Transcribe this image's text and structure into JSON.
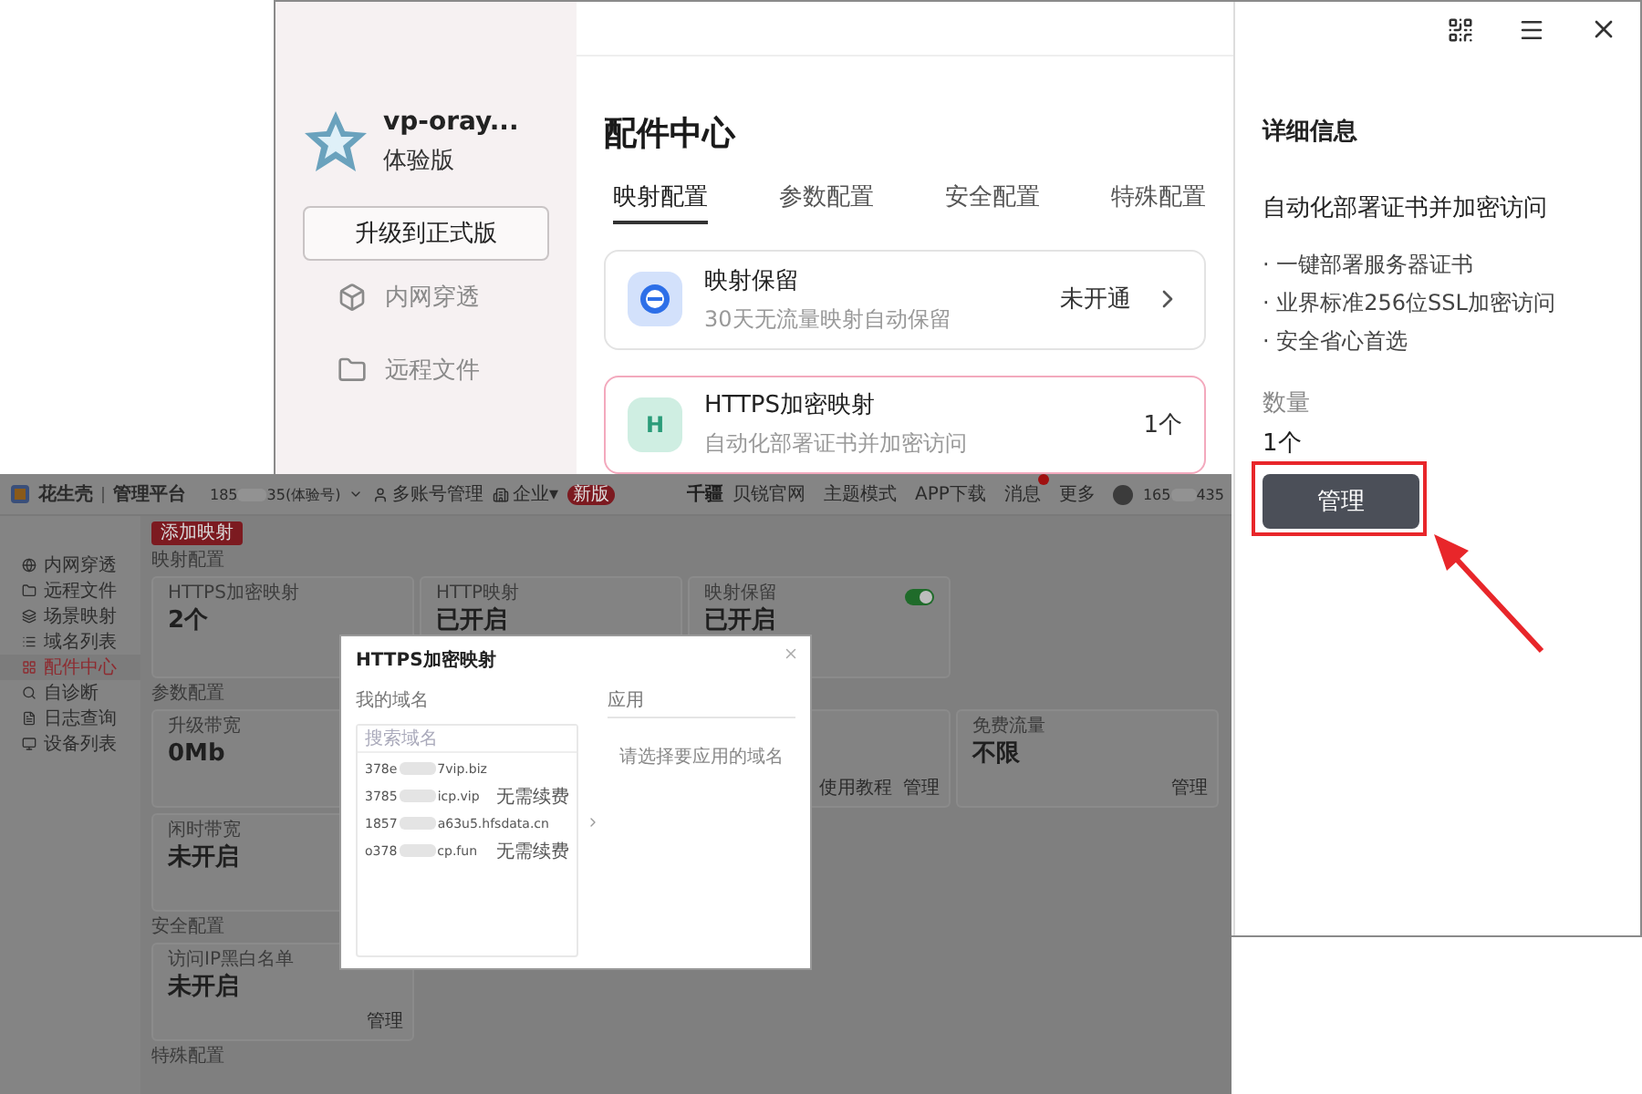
{
  "app_window": {
    "sidebar": {
      "account_name": "vp-oray...",
      "edition": "体验版",
      "upgrade_button": "升级到正式版",
      "nav": [
        "内网穿透",
        "远程文件"
      ]
    },
    "main": {
      "title": "配件中心",
      "tabs": [
        {
          "label": "映射配置",
          "selected": true
        },
        {
          "label": "参数配置",
          "selected": false
        },
        {
          "label": "安全配置",
          "selected": false
        },
        {
          "label": "特殊配置",
          "selected": false
        }
      ],
      "features": [
        {
          "kind": "reserve",
          "name": "映射保留",
          "description": "30天无流量映射自动保留",
          "status": "未开通",
          "chevron": true,
          "selected": false
        },
        {
          "kind": "https",
          "icon_letter": "H",
          "name": "HTTPS加密映射",
          "description": "自动化部署证书并加密访问",
          "status": "1个",
          "chevron": false,
          "selected": true
        }
      ]
    },
    "details": {
      "heading": "详细信息",
      "title": "自动化部署证书并加密访问",
      "bullets": [
        "· 一键部署服务器证书",
        "· 业界标准256位SSL加密访问",
        "· 安全省心首选"
      ],
      "quantity_label": "数量",
      "quantity": "1个",
      "button": "管理"
    }
  },
  "console": {
    "brand": "花生壳",
    "product": "管理平台",
    "account_prefix": "185",
    "account_suffix": "35(体验号)",
    "header_links": [
      "多账号管理",
      "企业▾"
    ],
    "new_badge": "新版",
    "partner_logo": "千疆",
    "top_nav": [
      {
        "label": "贝锐官网",
        "notification": false
      },
      {
        "label": "主题模式",
        "notification": false
      },
      {
        "label": "APP下载",
        "notification": false
      },
      {
        "label": "消息",
        "notification": true
      },
      {
        "label": "更多",
        "notification": false
      }
    ],
    "user_prefix": "165",
    "user_suffix": "435",
    "sidebar": [
      {
        "label": "内网穿透",
        "selected": false
      },
      {
        "label": "远程文件",
        "selected": false
      },
      {
        "label": "场景映射",
        "selected": false
      },
      {
        "label": "域名列表",
        "selected": false
      },
      {
        "label": "配件中心",
        "selected": true
      },
      {
        "label": "自诊断",
        "selected": false
      },
      {
        "label": "日志查询",
        "selected": false
      },
      {
        "label": "设备列表",
        "selected": false
      }
    ],
    "add_button": "添加映射",
    "sections": [
      {
        "title": "映射配置",
        "cards": [
          {
            "kind": "stat",
            "title": "HTTPS加密映射",
            "value": "2个"
          },
          {
            "kind": "stat",
            "title": "HTTP映射",
            "value": "已开启"
          },
          {
            "kind": "stat",
            "title": "映射保留",
            "value": "已开启",
            "toggle_on": true
          }
        ]
      },
      {
        "title": "参数配置",
        "cards": [
          {
            "kind": "stat",
            "title": "升级带宽",
            "value": "0Mb"
          },
          {
            "kind": "links",
            "links": [
              "使用教程",
              "管理"
            ]
          },
          {
            "kind": "stat",
            "title": "免费流量",
            "value": "不限",
            "links": [
              "管理"
            ]
          },
          {
            "kind": "stat",
            "title": "闲时带宽",
            "value": "未开启"
          }
        ]
      },
      {
        "title": "安全配置",
        "cards": [
          {
            "kind": "stat",
            "title": "访问IP黑白名单",
            "value": "未开启",
            "links": [
              "管理"
            ]
          }
        ]
      },
      {
        "title": "特殊配置"
      }
    ],
    "modal": {
      "title": "HTTPS加密映射",
      "left_label": "我的域名",
      "search_placeholder": "搜索域名",
      "domains": [
        {
          "start": "378e",
          "end": "7vip.biz"
        },
        {
          "start": "3785",
          "end": "icp.vip",
          "note": "无需续费"
        },
        {
          "start": "1857",
          "end": "a63u5.hfsdata.cn"
        },
        {
          "start": "o378",
          "end": "cp.fun",
          "note": "无需续费"
        }
      ],
      "right_label": "应用",
      "empty_text": "请选择要应用的域名"
    }
  }
}
